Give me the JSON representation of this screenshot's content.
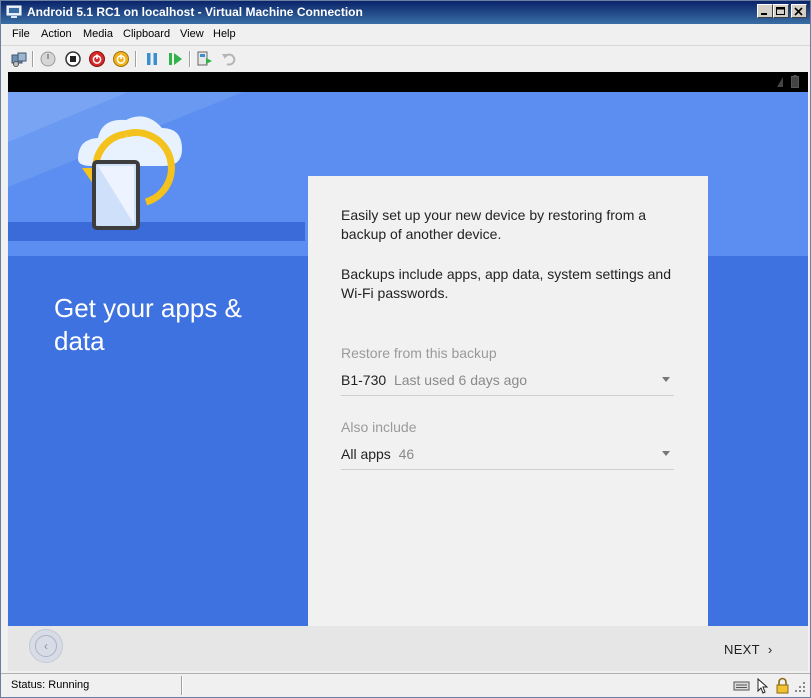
{
  "window": {
    "title": "Android 5.1 RC1 on localhost - Virtual Machine Connection"
  },
  "menu": [
    "File",
    "Action",
    "Media",
    "Clipboard",
    "View",
    "Help"
  ],
  "toolbar": {
    "icons": [
      "ctrl-alt-del-icon",
      "start-icon",
      "turn-off-icon",
      "shut-down-icon",
      "save-icon",
      "pause-icon",
      "reset-icon",
      "snapshot-icon",
      "revert-icon"
    ]
  },
  "android": {
    "heading": "Get your apps & data",
    "intro": "Easily set up your new device by restoring from a backup of another device.",
    "backups_info": "Backups include apps, app data, system settings and Wi-Fi passwords.",
    "restore_label": "Restore from this backup",
    "restore_device": "B1-730",
    "restore_last_used": "Last used 6 days ago",
    "also_label": "Also include",
    "also_value": "All apps",
    "also_count": "46",
    "next_label": "NEXT",
    "next_chevron": "›",
    "back_chevron": "‹"
  },
  "status": {
    "text": "Status: Running"
  },
  "colors": {
    "hero_top": "#5b8ef0",
    "hero_bottom": "#3d72e0",
    "card": "#f1f1f1",
    "title_bar": "#0a246a"
  }
}
